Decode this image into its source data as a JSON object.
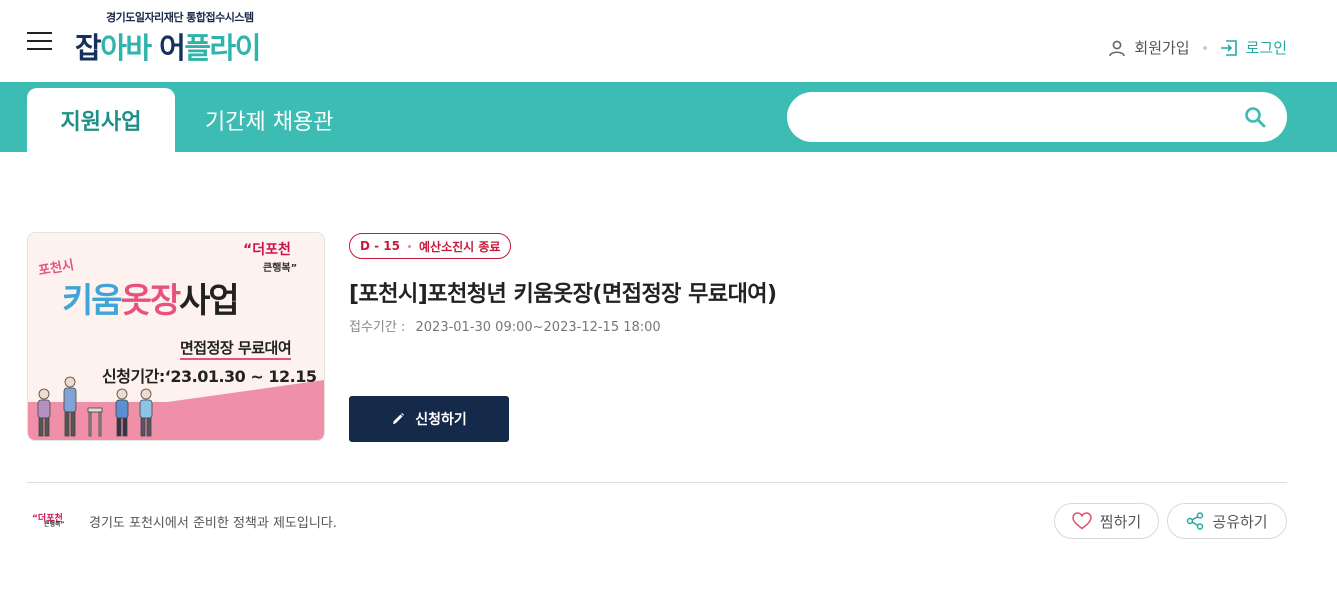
{
  "header": {
    "logo_subtitle": "경기도일자리재단 통합접수시스템",
    "logo_part1": "잡",
    "logo_part2": "아바",
    "logo_part3": "어",
    "logo_part4": "플라이",
    "signup_label": "회원가입",
    "login_label": "로그인"
  },
  "tabs": [
    {
      "label": "지원사업",
      "active": true
    },
    {
      "label": "기간제 채용관",
      "active": false
    }
  ],
  "search": {
    "placeholder": "",
    "value": ""
  },
  "program": {
    "badge_dday": "D - 15",
    "badge_status": "예산소진시 종료",
    "title": "[포천시]포천청년 키움옷장(면접정장 무료대여)",
    "period_label": "접수기간 :",
    "period_value": "2023-01-30 09:00~2023-12-15 18:00",
    "apply_label": "신청하기",
    "thumbnail": {
      "city": "포천시",
      "brand_line1": "“더포천",
      "brand_line2": "큰행복”",
      "title_a": "키움",
      "title_b": "옷장",
      "title_c": "사업",
      "subtitle": "면접정장 무료대여",
      "period": "신청기간:‘23.01.30 ~ 12.15"
    }
  },
  "footer": {
    "org_logo_line1": "“더포천",
    "org_logo_line2": "큰행복”",
    "org_text": "경기도 포천시에서 준비한 정책과 제도입니다.",
    "favorite_label": "찜하기",
    "share_label": "공유하기"
  },
  "colors": {
    "teal": "#3dbcb4",
    "navy": "#15294a",
    "badge_red": "#c81b3a"
  }
}
